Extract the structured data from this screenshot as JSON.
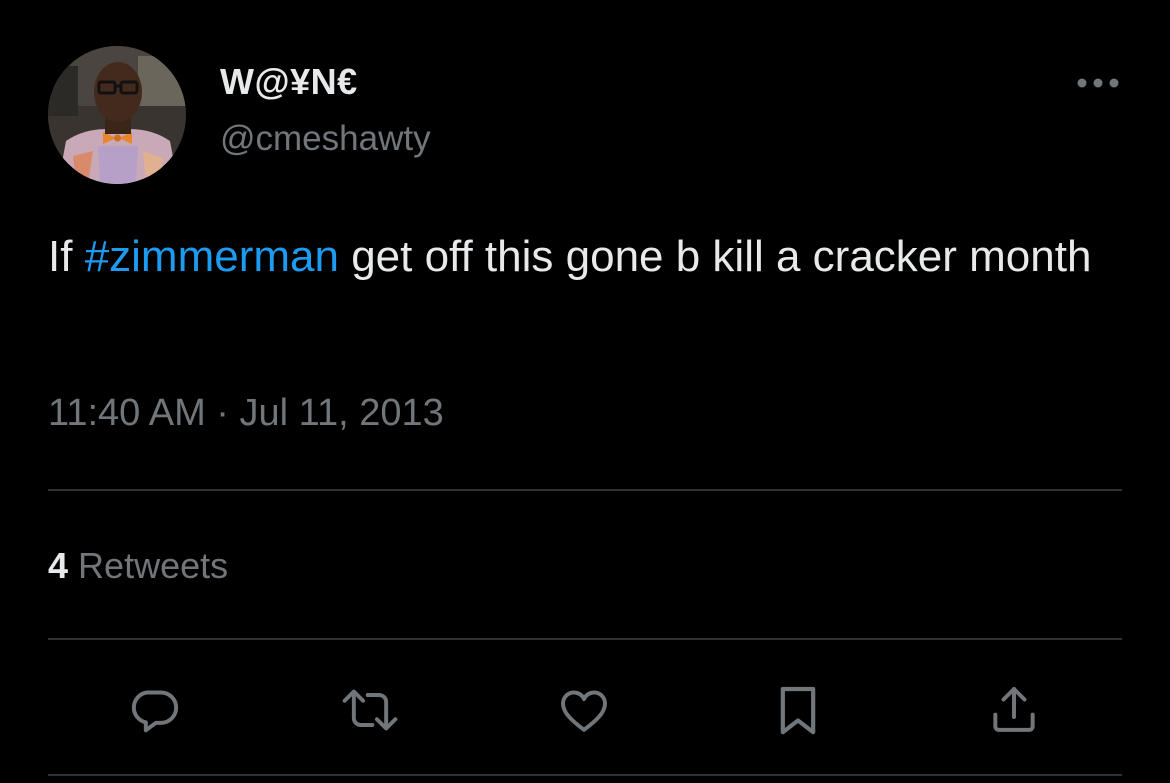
{
  "tweet": {
    "author": {
      "display_name": "W@¥N€",
      "handle": "@cmeshawty",
      "avatar_icon": "user-avatar-photo"
    },
    "text_before": "If ",
    "hashtag": "#zimmerman",
    "text_after": " get off this gone b kill a cracker month",
    "timestamp": "11:40 AM · Jul 11, 2013",
    "stats": {
      "retweet_count": "4",
      "retweet_label": "Retweets"
    },
    "actions": [
      {
        "name": "reply",
        "icon": "reply-icon"
      },
      {
        "name": "retweet",
        "icon": "retweet-icon"
      },
      {
        "name": "like",
        "icon": "heart-icon"
      },
      {
        "name": "bookmark",
        "icon": "bookmark-icon"
      },
      {
        "name": "share",
        "icon": "share-icon"
      }
    ],
    "colors": {
      "background": "#000000",
      "text": "#e7e9ea",
      "secondary": "#71767b",
      "link": "#1d9bf0",
      "divider": "#2f3336"
    }
  }
}
